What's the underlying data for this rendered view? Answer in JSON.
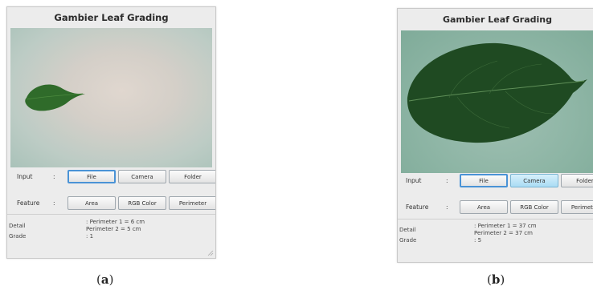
{
  "panels": [
    {
      "title": "Gambier Leaf Grading",
      "input_label": "Input",
      "feature_label": "Feature",
      "colon": ":",
      "buttons": {
        "file": "File",
        "camera": "Camera",
        "folder": "Folder",
        "area": "Area",
        "rgb": "RGB Color",
        "perimeter": "Perimeter"
      },
      "detail_label": "Detail",
      "detail_line1": ": Perimeter 1 = 6 cm",
      "detail_line2": "  Perimeter 2 = 5 cm",
      "grade_label": "Grade",
      "grade_value": ": 1",
      "caption": "(a)",
      "caption_letter": "a"
    },
    {
      "title": "Gambier Leaf Grading",
      "input_label": "Input",
      "feature_label": "Feature",
      "colon": ":",
      "buttons": {
        "file": "File",
        "camera": "Camera",
        "folder": "Folder",
        "area": "Area",
        "rgb": "RGB Color",
        "perimeter": "Perimeter"
      },
      "detail_label": "Detail",
      "detail_line1": ": Perimeter 1 = 37 cm",
      "detail_line2": "  Perimeter 2 = 37 cm",
      "grade_label": "Grade",
      "grade_value": ": 5",
      "caption": "(b)",
      "caption_letter": "b"
    }
  ],
  "colors": {
    "leaf": "#2f6b2a",
    "leaf_dark": "#1f4a22",
    "focus_border": "#4a93d6",
    "pressed_bg": "#a9dcf4"
  }
}
